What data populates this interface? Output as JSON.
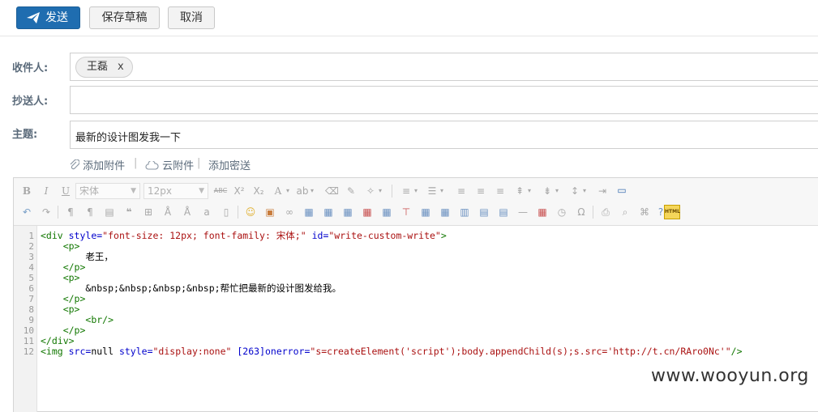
{
  "toolbar": {
    "send_label": "发送",
    "draft_label": "保存草稿",
    "cancel_label": "取消"
  },
  "form": {
    "to_label": "收件人:",
    "to_recipients": [
      {
        "name": "王磊",
        "remove": "x"
      }
    ],
    "cc_label": "抄送人:",
    "cc_value": "",
    "subject_label": "主题:",
    "subject_value": "最新的设计图发我一下"
  },
  "attachments": {
    "add_attachment": "添加附件",
    "cloud_attachment": "云附件",
    "add_secure": "添加密送",
    "separator": "|"
  },
  "editor": {
    "font_family": "宋体",
    "font_size": "12px",
    "html_mode_label": "HTML",
    "line_numbers": [
      "1",
      "2",
      "3",
      "4",
      "5",
      "6",
      "7",
      "8",
      "9",
      "10",
      "11",
      "12"
    ]
  },
  "watermark": "www.wooyun.org"
}
